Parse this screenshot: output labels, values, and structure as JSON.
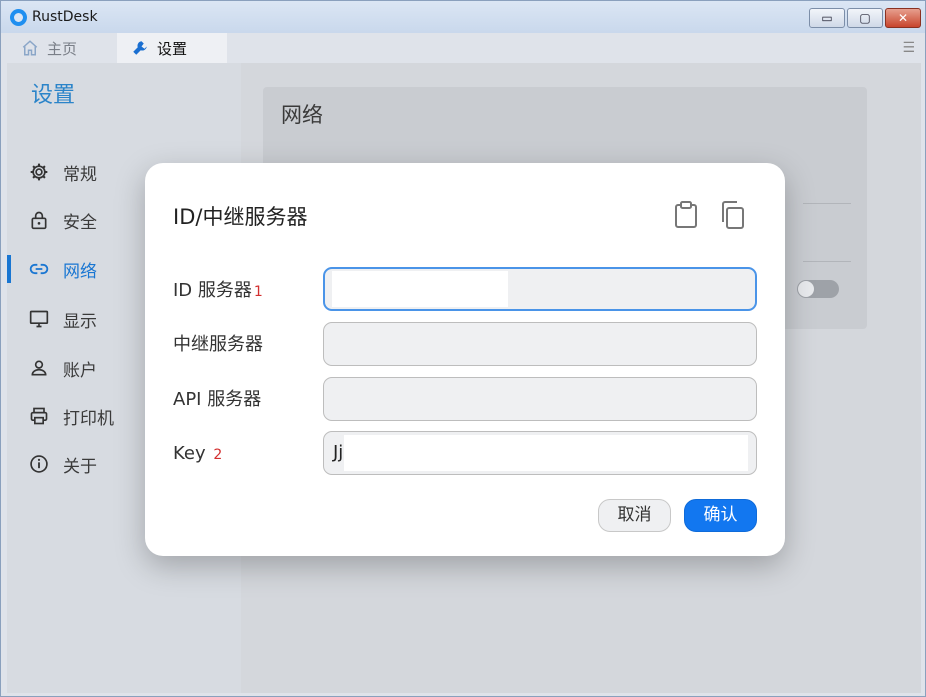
{
  "app": {
    "title": "RustDesk"
  },
  "window_controls": {
    "minimize": "▭",
    "maximize": "▢",
    "close": "✕"
  },
  "tabs": [
    {
      "label": "主页",
      "icon": "home-icon"
    },
    {
      "label": "设置",
      "icon": "wrench-icon"
    }
  ],
  "sidebar": {
    "title": "设置",
    "items": [
      {
        "label": "常规",
        "icon": "gear-icon"
      },
      {
        "label": "安全",
        "icon": "lock-icon"
      },
      {
        "label": "网络",
        "icon": "link-icon",
        "active": true
      },
      {
        "label": "显示",
        "icon": "monitor-icon"
      },
      {
        "label": "账户",
        "icon": "person-icon"
      },
      {
        "label": "打印机",
        "icon": "printer-icon"
      },
      {
        "label": "关于",
        "icon": "info-icon"
      }
    ]
  },
  "main": {
    "card_title": "网络"
  },
  "dialog": {
    "title": "ID/中继服务器",
    "fields": [
      {
        "label": "ID 服务器",
        "mark": "1",
        "value": ""
      },
      {
        "label": "中继服务器",
        "mark": "",
        "value": ""
      },
      {
        "label": "API 服务器",
        "mark": "",
        "value": ""
      },
      {
        "label": "Key",
        "mark": "2",
        "value": "Jj"
      }
    ],
    "cancel_label": "取消",
    "ok_label": "确认"
  },
  "colors": {
    "accent": "#1976d2",
    "primary_button": "#1277f0",
    "mark": "#d32f2f"
  }
}
